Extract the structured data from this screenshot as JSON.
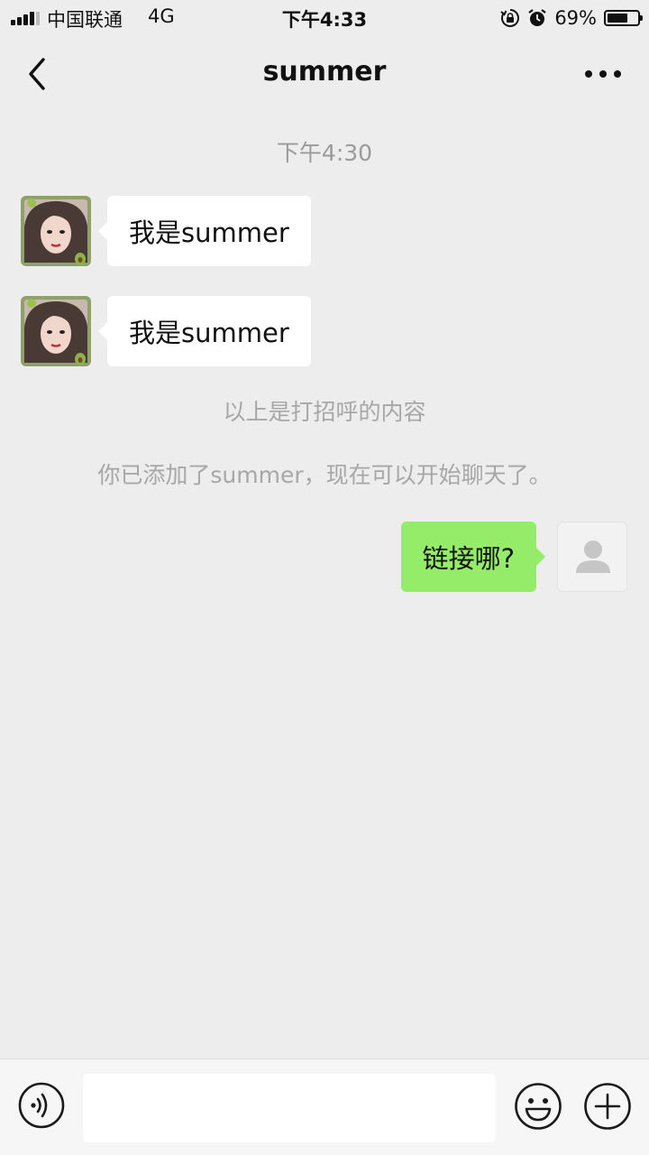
{
  "status_bar": {
    "carrier": "中国联通",
    "network": "4G",
    "time": "下午4:33",
    "battery_percent_label": "69%",
    "battery_level": 0.69,
    "icons": [
      "signal-icon",
      "rotation-lock-icon",
      "alarm-icon",
      "battery-icon"
    ]
  },
  "nav": {
    "title": "summer",
    "back_icon": "chevron-left-icon",
    "more_icon": "more-dots-icon"
  },
  "chat": {
    "timestamp": "下午4:30",
    "messages": [
      {
        "sender": "contact",
        "text": "我是summer"
      },
      {
        "sender": "contact",
        "text": "我是summer"
      },
      {
        "sender": "self",
        "text": "链接哪?"
      }
    ],
    "system_notes": [
      "以上是打招呼的内容",
      "你已添加了summer，现在可以开始聊天了。"
    ]
  },
  "input_bar": {
    "text_value": "",
    "voice_icon": "voice-icon",
    "emoji_icon": "emoji-icon",
    "plus_icon": "plus-icon"
  },
  "colors": {
    "background": "#ededed",
    "outgoing_bubble": "#95ec69",
    "incoming_bubble": "#ffffff",
    "system_text": "#a7a7a7"
  }
}
